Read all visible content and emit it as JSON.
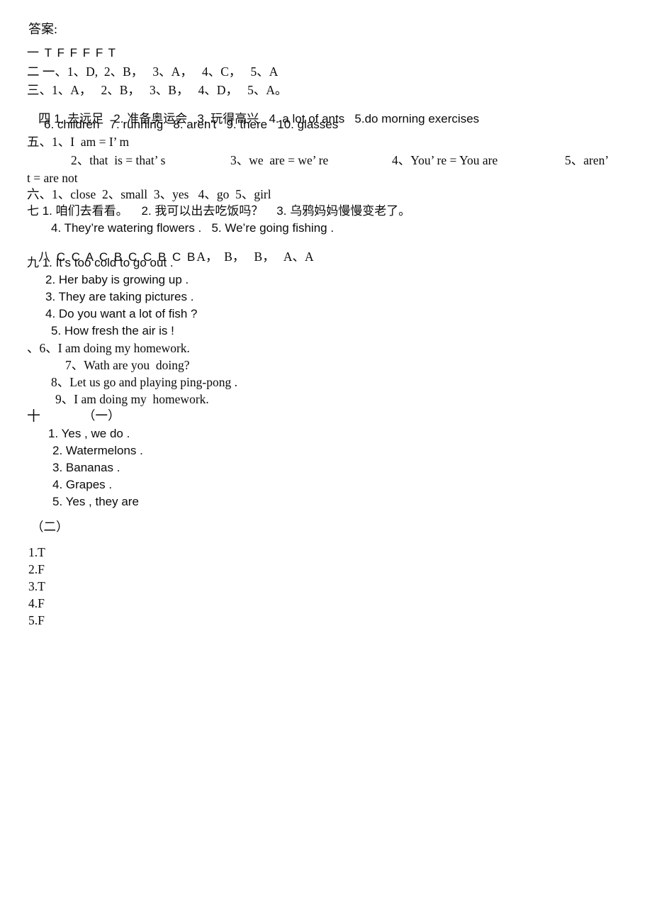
{
  "document": {
    "title": "答案:",
    "background_color": "#ffffff",
    "text_color": "#0a0a0a"
  },
  "sections": {
    "heading": "答案:",
    "s1": {
      "marker": "一",
      "answers": "T F F F F T",
      "full": "一 T F F F F T"
    },
    "s2": {
      "marker": "二",
      "full": "二 一、1、D,  2、B，   3、A，   4、C，   5、A"
    },
    "s3": {
      "marker": "三",
      "full": "三、1、A，   2、B，   3、B，   4、D，   5、A。"
    },
    "s4": {
      "marker": "四",
      "line1_sans": "1. 去远足   2. 准备奥运会   3. 玩得高兴   4. a lot of ants   5.do morning exercises",
      "line2_sans": "6. children   7. running   8. aren't   9. there   10. glasses"
    },
    "s5": {
      "marker": "五",
      "line1": "五、1、I  am = I’ m",
      "line2_item2": "2、that  is = that’ s",
      "line2_item3": "3、we  are = we’ re",
      "line2_item4": "4、You’ re = You are",
      "line2_item5": "5、aren’",
      "line3": "t = are not"
    },
    "s6": {
      "marker": "六",
      "full": "六、1、close  2、small  3、yes   4、go  5、girl"
    },
    "s7": {
      "marker": "七",
      "line1": "七 1. 咱们去看看。    2. 我可以出去吃饭吗？    3. 乌鸦妈妈慢慢变老了。",
      "line2": "4. They’re watering flowers .   5. We’re going fishing ."
    },
    "s8": {
      "marker": "八",
      "sans_part": "八 C C A C B C C B C B",
      "serif_part": "A，  B，   B，   A、A"
    },
    "s9": {
      "marker": "九",
      "items_sans": [
        "九 1. It’s too cold to go out .",
        "2. Her baby is growing up .",
        "3. They are taking pictures .",
        "4. Do you want a lot of fish ?",
        "5. How fresh the air is !"
      ],
      "items_serif": [
        "、6、I am doing my homework.",
        "7、Wath are you  doing?",
        "8、Let us go and playing ping-pong .",
        "9、I am doing my  homework."
      ]
    },
    "s10": {
      "marker": "十",
      "sub1_label": "（一）",
      "sub1_items": [
        "1. Yes , we do .",
        "2. Watermelons .",
        "3. Bananas .",
        "4. Grapes .",
        "5. Yes , they are"
      ],
      "sub2_label": "（二）",
      "sub2_items": [
        "1.T",
        "2.F",
        "3.T",
        "4.F",
        "5.F"
      ]
    }
  }
}
